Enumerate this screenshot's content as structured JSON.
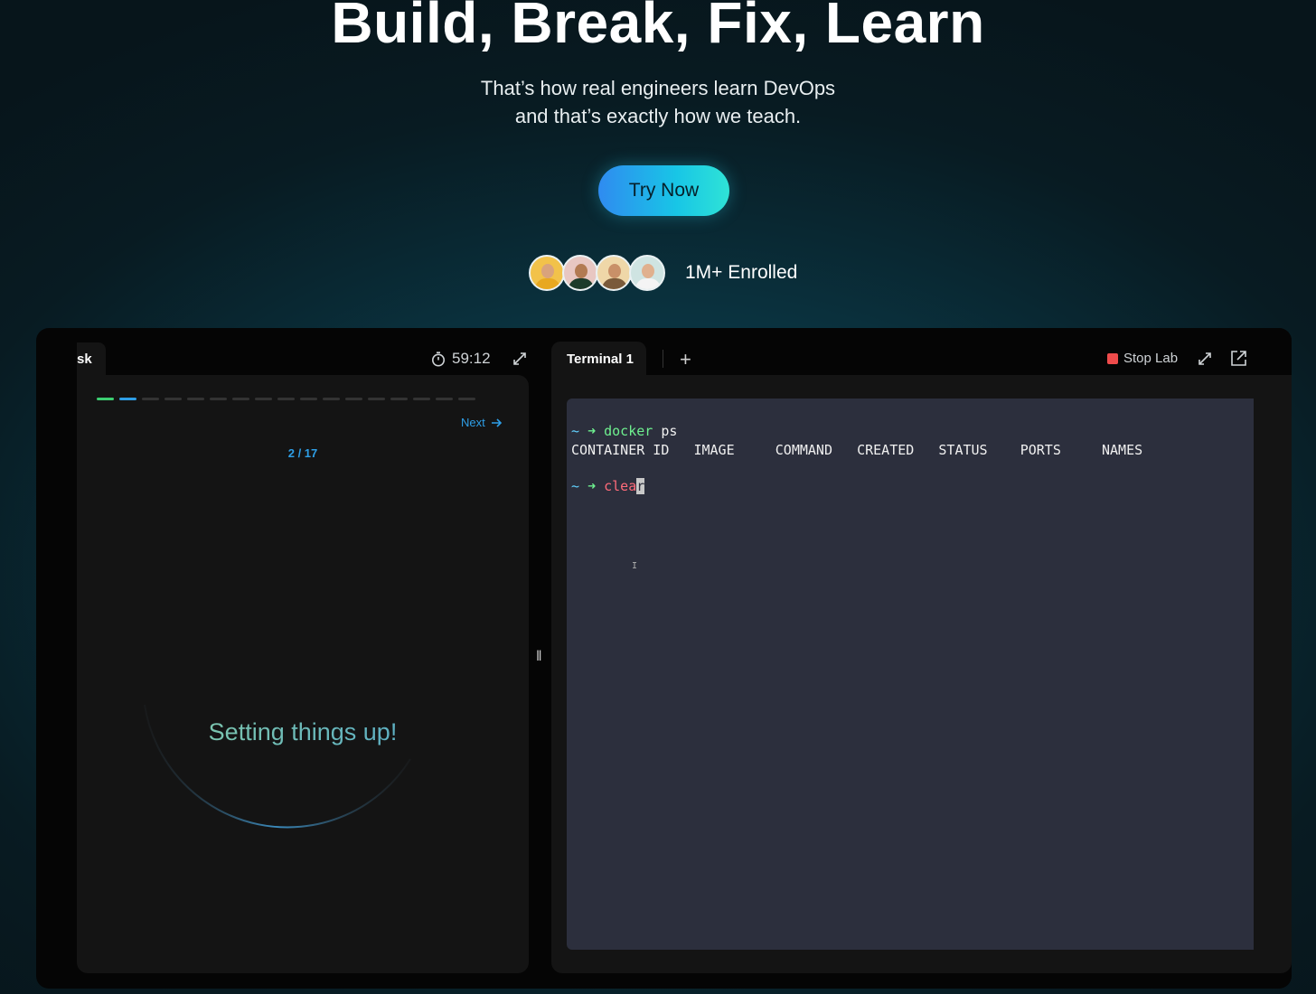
{
  "hero": {
    "title": "Build, Break, Fix, Learn",
    "subtitle_line1": "That’s how real engineers learn DevOps",
    "subtitle_line2": "and that’s exactly how we teach.",
    "cta_label": "Try Now",
    "enrolled_label": "1M+ Enrolled",
    "avatars": [
      "avatar-1",
      "avatar-2",
      "avatar-3",
      "avatar-4"
    ]
  },
  "lab": {
    "task_tab_label": "sk",
    "timer": "59:12",
    "progress": {
      "completed_steps": 2,
      "total_steps": 17,
      "step_text": "2 / 17"
    },
    "next_label": "Next",
    "loader_text": "Setting things up!",
    "divider_glyph": "‖",
    "terminal_tab_label": "Terminal 1",
    "add_tab_glyph": "+",
    "stop_label": "Stop Lab",
    "terminal": {
      "prompt_tilde": "~",
      "prompt_arrow": "➜",
      "cmd1": "docker",
      "cmd1_args": " ps",
      "header": "CONTAINER ID   IMAGE     COMMAND   CREATED   STATUS    PORTS     NAMES",
      "cmd2_typed": "clea",
      "cmd2_cursor": "r",
      "ibeam_glyph": "I"
    }
  },
  "colors": {
    "accent": "#2e9ee6",
    "cta_gradient_start": "#2f8bf0",
    "cta_gradient_end": "#2fe3d6",
    "stop": "#ef4b4b",
    "terminal_bg": "#2c2f3d"
  },
  "icons": [
    "stopwatch-icon",
    "expand-icon",
    "arrow-right-icon",
    "plus-icon",
    "stop-icon",
    "popout-icon"
  ]
}
